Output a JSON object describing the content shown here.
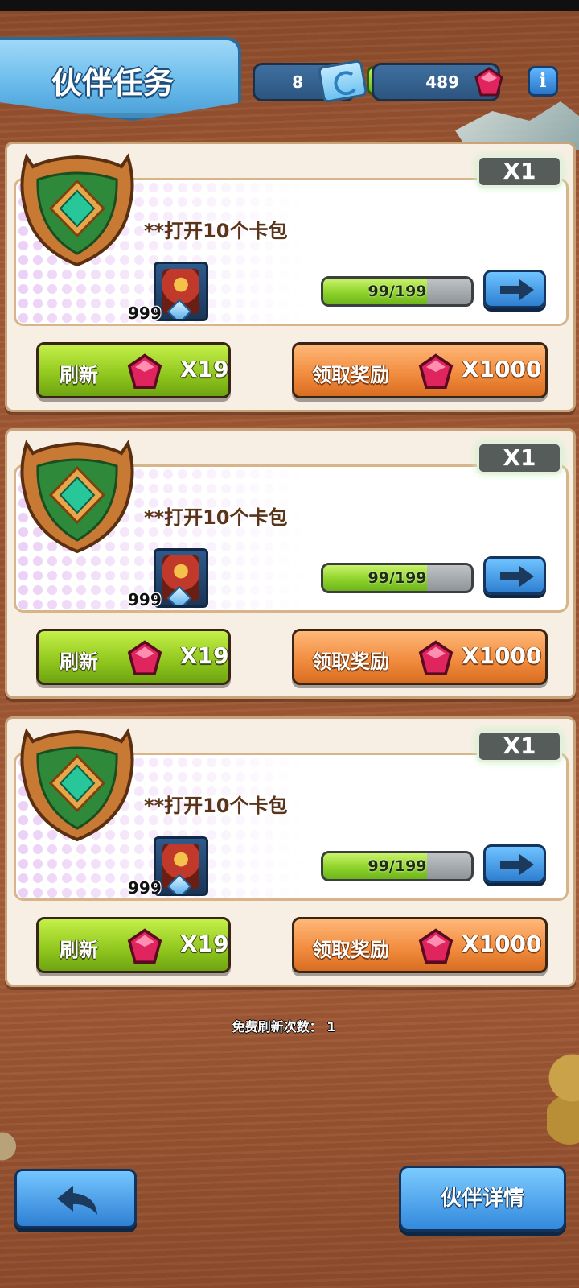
{
  "header": {
    "title": "伙伴任务",
    "tickets": "8",
    "gems": "489",
    "plus_symbol": "+",
    "info_symbol": "i"
  },
  "tasks": [
    {
      "count_tag": "X1",
      "title": "**打开10个卡包",
      "reward_count": "999",
      "progress": {
        "text": "99/199",
        "fraction": 0.7
      },
      "refresh": {
        "label": "刷新",
        "cost": "X19"
      },
      "claim": {
        "label": "领取奖励",
        "amount": "X1000"
      }
    },
    {
      "count_tag": "X1",
      "title": "**打开10个卡包",
      "reward_count": "999",
      "progress": {
        "text": "99/199",
        "fraction": 0.7
      },
      "refresh": {
        "label": "刷新",
        "cost": "X19"
      },
      "claim": {
        "label": "领取奖励",
        "amount": "X1000"
      }
    },
    {
      "count_tag": "X1",
      "title": "**打开10个卡包",
      "reward_count": "999",
      "progress": {
        "text": "99/199",
        "fraction": 0.7
      },
      "refresh": {
        "label": "刷新",
        "cost": "X19"
      },
      "claim": {
        "label": "领取奖励",
        "amount": "X1000"
      }
    }
  ],
  "footer": {
    "free_refresh": "免费刷新次数： 1",
    "detail_label": "伙伴详情"
  },
  "colors": {
    "accent_blue": "#2e7fd1",
    "refresh_green": "#8fc61d",
    "claim_orange": "#f08a3c",
    "gem_red": "#e0245e"
  },
  "icons": [
    "ticket-icon",
    "gem-icon",
    "plus-icon",
    "info-icon",
    "arrow-right-icon",
    "back-arrow-icon",
    "emerald-badge-icon"
  ]
}
